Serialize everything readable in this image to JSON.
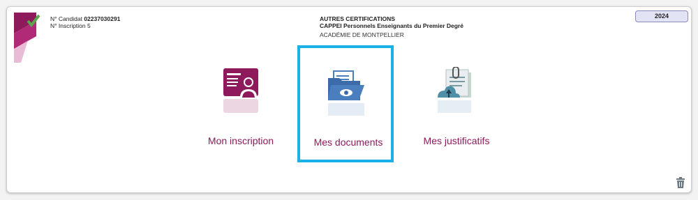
{
  "candidate": {
    "number_label": "N° Candidat",
    "number_value": "02237030291",
    "inscription": "N° Inscription 5"
  },
  "header": {
    "title": "AUTRES CERTIFICATIONS",
    "subtitle": "CAPPEI Personnels Enseignants du Premier Degré",
    "academy": "ACADÉMIE DE MONTPELLIER"
  },
  "year_badge": "2024",
  "tiles": [
    {
      "label": "Mon inscription",
      "icon": "id-card-icon"
    },
    {
      "label": "Mes documents",
      "icon": "documents-folder-icon",
      "selected": true
    },
    {
      "label": "Mes justificatifs",
      "icon": "clipboard-upload-icon"
    }
  ],
  "colors": {
    "brand": "#8e1a5c",
    "selection": "#1ab0e8",
    "docs_blue": "#4a7ebf"
  }
}
